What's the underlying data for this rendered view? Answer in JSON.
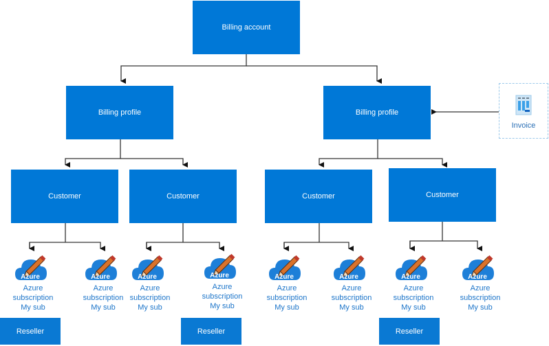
{
  "diagram": {
    "billing_account": {
      "label": "Billing account"
    },
    "billing_profiles": [
      {
        "label": "Billing profile"
      },
      {
        "label": "Billing profile"
      }
    ],
    "customers": [
      {
        "label": "Customer"
      },
      {
        "label": "Customer"
      },
      {
        "label": "Customer"
      },
      {
        "label": "Customer"
      }
    ],
    "subscriptions": [
      {
        "badge": "Azure",
        "line1": "Azure",
        "line2": "subscription",
        "line3": "My sub"
      },
      {
        "badge": "Azure",
        "line1": "Azure",
        "line2": "subscription",
        "line3": "My sub"
      },
      {
        "badge": "Azure",
        "line1": "Azure",
        "line2": "subscription",
        "line3": "My sub"
      },
      {
        "badge": "Azure",
        "line1": "Azure",
        "line2": "subscription",
        "line3": "My sub"
      },
      {
        "badge": "Azure",
        "line1": "Azure",
        "line2": "subscription",
        "line3": "My sub"
      },
      {
        "badge": "Azure",
        "line1": "Azure",
        "line2": "subscription",
        "line3": "My sub"
      },
      {
        "badge": "Azure",
        "line1": "Azure",
        "line2": "subscription",
        "line3": "My sub"
      },
      {
        "badge": "Azure",
        "line1": "Azure",
        "line2": "subscription",
        "line3": "My sub"
      }
    ],
    "resellers": [
      {
        "label": "Reseller"
      },
      {
        "label": "Reseller"
      },
      {
        "label": "Reseller"
      }
    ],
    "invoice": {
      "label": "Invoice",
      "icon": "invoice-icon"
    },
    "colors": {
      "box": "#0078d7",
      "subscription_text": "#1b74c9",
      "connector": "#333333"
    }
  }
}
